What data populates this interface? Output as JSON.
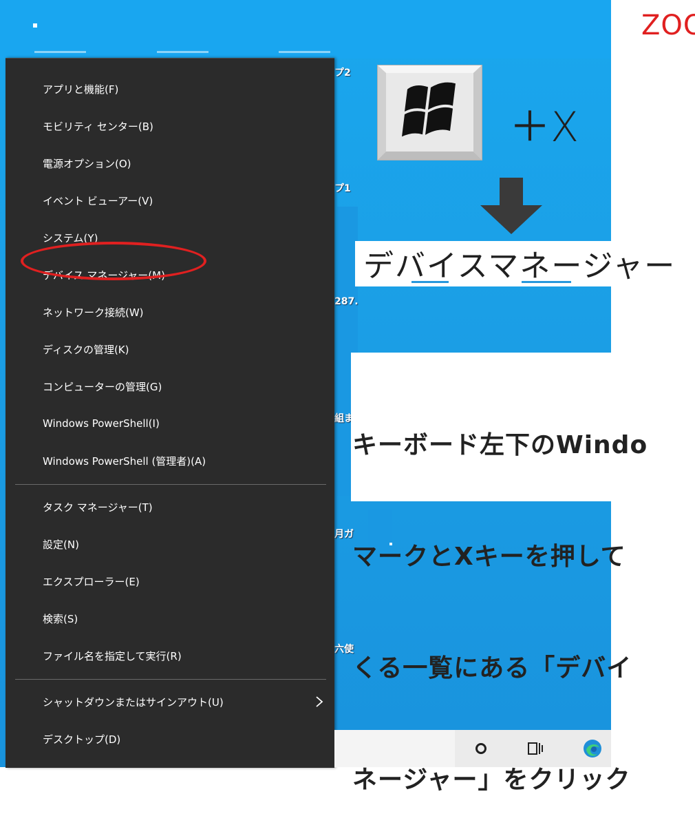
{
  "desktop": {
    "peek_labels": [
      "プ2",
      "プ1",
      "287.",
      "組ま",
      "月ガ",
      "六使"
    ]
  },
  "menu": {
    "items": [
      {
        "label": "アプリと機能(F)"
      },
      {
        "label": "モビリティ センター(B)"
      },
      {
        "label": "電源オプション(O)"
      },
      {
        "label": "イベント ビューアー(V)"
      },
      {
        "label": "システム(Y)"
      },
      {
        "label": "デバイス マネージャー(M)"
      },
      {
        "label": "ネットワーク接続(W)"
      },
      {
        "label": "ディスクの管理(K)"
      },
      {
        "label": "コンピューターの管理(G)"
      },
      {
        "label": "Windows PowerShell(I)"
      },
      {
        "label": "Windows PowerShell (管理者)(A)"
      },
      {
        "label": "タスク マネージャー(T)"
      },
      {
        "label": "設定(N)"
      },
      {
        "label": "エクスプローラー(E)"
      },
      {
        "label": "検索(S)"
      },
      {
        "label": "ファイル名を指定して実行(R)"
      },
      {
        "label": "シャットダウンまたはサインアウト(U)"
      },
      {
        "label": "デスクトップ(D)"
      }
    ],
    "highlighted_item": "デバイス マネージャー(M)",
    "highlight_color": "#e02020"
  },
  "annotation": {
    "zoom_label": "ZOO",
    "key_combo": "＋X",
    "target_label": "デバイスマネージャー",
    "instruction_lines": [
      "キーボード左下のWindo",
      "マークとXキーを押して",
      "くる一覧にある「デバイ",
      "ネージャー」をクリック"
    ]
  },
  "icons": {
    "windows_key": "windows-logo-icon",
    "arrow": "down-arrow-icon",
    "submenu": "chevron-right-icon",
    "cortana": "cortana-icon",
    "task_view": "task-view-icon",
    "edge": "edge-icon"
  },
  "colors": {
    "menu_bg": "#2b2b2b",
    "desktop_blue": "#1aa7ee",
    "annotation_red": "#e02020"
  }
}
